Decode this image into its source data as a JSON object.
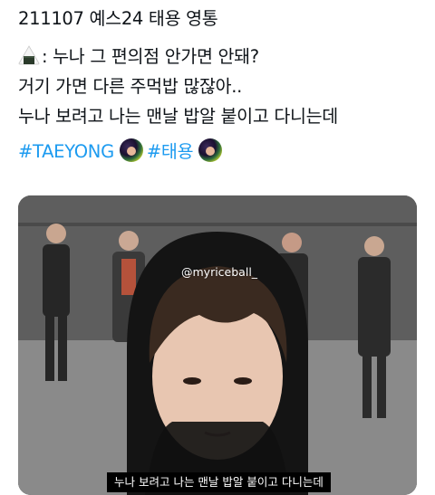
{
  "tweet": {
    "header_line": "211107 예스24 태용 영통",
    "quote_line_1": "누나 그 편의점 안가면 안돼?",
    "quote_line_2": "거기 가면 다른 주먹밥 많잖아..",
    "quote_line_3": "누나 보려고 나는 맨날 밥알 붙이고 다니는데",
    "quote_prefix": ": ",
    "hashtag_1": "#TAEYONG",
    "hashtag_2": "#태용",
    "speaker_icon": "rice-ball-icon",
    "hashtag_icon": "taeyong-avatar-icon"
  },
  "media": {
    "watermark": "@myriceball_",
    "subtitle": "누나 보려고 나는 맨날 밥알 붙이고 다니는데"
  },
  "colors": {
    "hashtag": "#1d9bf0",
    "text": "#0f1419",
    "background": "#ffffff"
  }
}
